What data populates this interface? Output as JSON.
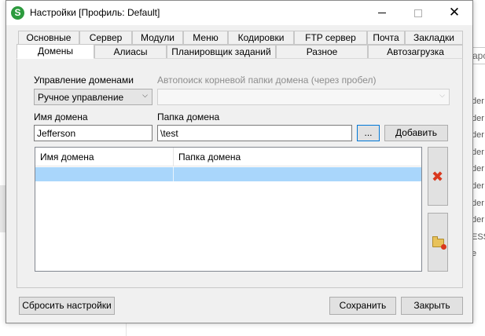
{
  "background": {
    "search_fragment": "арch",
    "list_fragments": [
      "der",
      "der",
      "der",
      "der",
      "der",
      "der",
      "der",
      "der",
      "ESS",
      "e"
    ]
  },
  "window": {
    "title": "Настройки [Профиль: Default]",
    "icon_letter": "S",
    "accent_color": "#2d9b3e"
  },
  "tabs_row1": [
    "Основные",
    "Сервер",
    "Модули",
    "Меню",
    "Кодировки",
    "FTP сервер",
    "Почта",
    "Закладки"
  ],
  "tabs_row2": [
    "Домены",
    "Алиасы",
    "Планировщик заданий",
    "Разное",
    "Автозагрузка"
  ],
  "active_tab": "Домены",
  "domains": {
    "management_label": "Управление доменами",
    "management_value": "Ручное управление",
    "autosearch_label": "Автопоиск корневой папки домена (через пробел)",
    "autosearch_value": "",
    "name_label": "Имя домена",
    "name_value": "Jefferson",
    "folder_label": "Папка домена",
    "folder_value": "\\test",
    "browse_label": "...",
    "add_label": "Добавить",
    "columns": [
      "Имя домена",
      "Папка домена"
    ],
    "selected_row": [
      "",
      ""
    ],
    "selection_color": "#a9d6fb",
    "delete_icon": "red-x-icon",
    "open_folder_icon": "folder-icon"
  },
  "footer": {
    "reset_label": "Сбросить настройки",
    "save_label": "Сохранить",
    "close_label": "Закрыть"
  }
}
